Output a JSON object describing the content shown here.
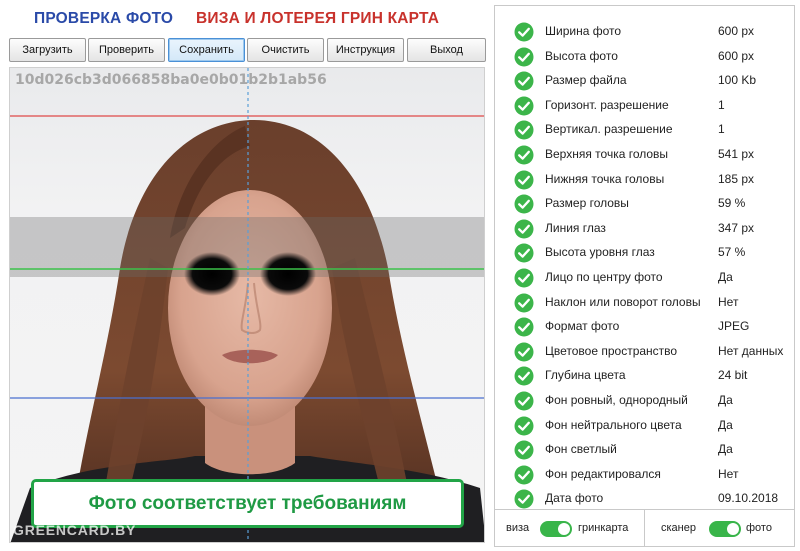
{
  "header": {
    "title_check": "ПРОВЕРКА ФОТО",
    "title_visa": "ВИЗА И ЛОТЕРЕЯ ГРИН КАРТА"
  },
  "toolbar": {
    "load": "Загрузить",
    "check": "Проверить",
    "save": "Сохранить",
    "clear": "Очистить",
    "instruction": "Инструкция",
    "exit": "Выход",
    "active_button": "save"
  },
  "photo": {
    "hash": "10d026cb3d066858ba0e0b01b2b1ab56",
    "status": "Фото соответствует требованиям",
    "watermark": "GREENCARD.BY"
  },
  "checks": [
    {
      "label": "Ширина фото",
      "value": "600 px",
      "status": "ok"
    },
    {
      "label": "Высота фото",
      "value": "600 px",
      "status": "ok"
    },
    {
      "label": "Размер файла",
      "value": "100 Kb",
      "status": "ok"
    },
    {
      "label": "Горизонт. разрешение",
      "value": "1",
      "status": "ok"
    },
    {
      "label": "Вертикал. разрешение",
      "value": "1",
      "status": "ok"
    },
    {
      "label": "Верхняя точка головы",
      "value": "541 px",
      "status": "ok"
    },
    {
      "label": "Нижняя точка головы",
      "value": "185 px",
      "status": "ok"
    },
    {
      "label": "Размер головы",
      "value": "59 %",
      "status": "ok"
    },
    {
      "label": "Линия глаз",
      "value": "347 px",
      "status": "ok"
    },
    {
      "label": "Высота уровня глаз",
      "value": "57 %",
      "status": "ok"
    },
    {
      "label": "Лицо по центру фото",
      "value": "Да",
      "status": "ok"
    },
    {
      "label": "Наклон или поворот головы",
      "value": "Нет",
      "status": "ok"
    },
    {
      "label": "Формат фото",
      "value": "JPEG",
      "status": "ok"
    },
    {
      "label": "Цветовое пространство",
      "value": "Нет данных",
      "status": "ok"
    },
    {
      "label": "Глубина цвета",
      "value": "24 bit",
      "status": "ok"
    },
    {
      "label": "Фон ровный, однородный",
      "value": "Да",
      "status": "ok"
    },
    {
      "label": "Фон нейтрального цвета",
      "value": "Да",
      "status": "ok"
    },
    {
      "label": "Фон светлый",
      "value": "Да",
      "status": "ok"
    },
    {
      "label": "Фон редактировался",
      "value": "Нет",
      "status": "ok"
    },
    {
      "label": "Дата фото",
      "value": "09.10.2018",
      "status": "ok"
    }
  ],
  "toggles": {
    "mode": {
      "left": "виза",
      "right": "гринкарта",
      "state": "right"
    },
    "source": {
      "left": "сканер",
      "right": "фото",
      "state": "right"
    }
  },
  "colors": {
    "title_blue": "#2a4aa8",
    "title_red": "#c8322c",
    "ok_green": "#3cb54a",
    "status_green": "#1f9a44",
    "top_line": "#e04848",
    "eye_line": "#3cc24a",
    "chin_line": "#4a6fd0",
    "center_line": "#5a9fd8"
  },
  "icons": {
    "check": "check-circle-icon",
    "toggle": "toggle-switch"
  }
}
